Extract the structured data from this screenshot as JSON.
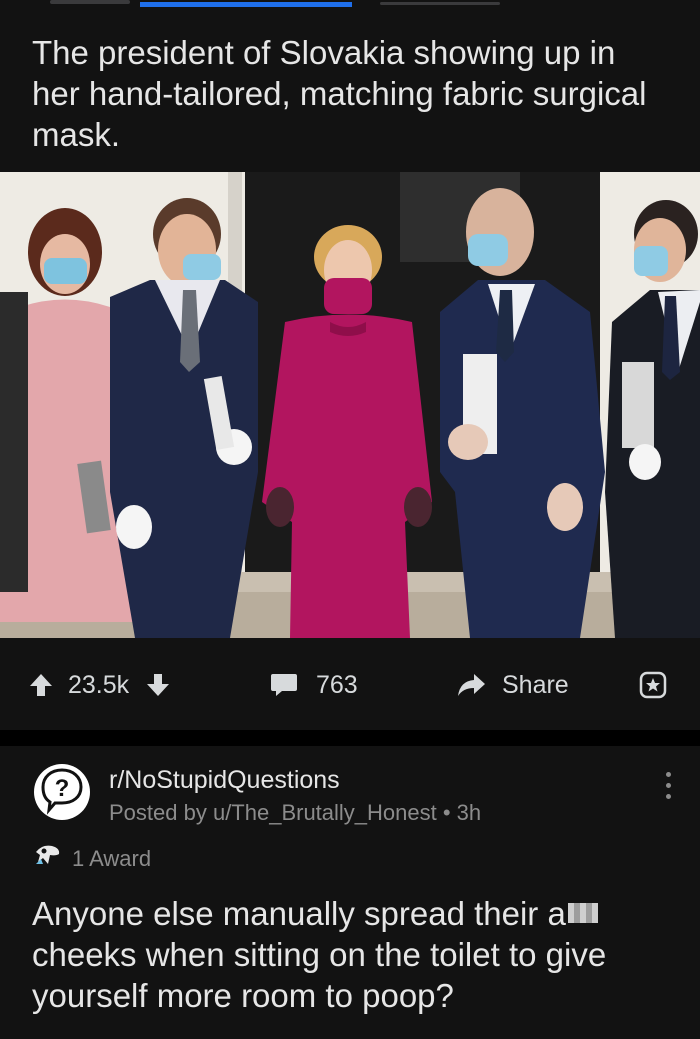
{
  "post1": {
    "title": "The president of Slovakia showing up in her hand-tailored, matching fabric surgical mask.",
    "image_alt": "Photo of the president of Slovakia in a magenta dress and matching mask standing with men in suits",
    "actions": {
      "score": "23.5k",
      "comments": "763",
      "share_label": "Share"
    }
  },
  "post2": {
    "subreddit": "r/NoStupidQuestions",
    "posted_by": "Posted by u/The_Brutally_Honest • 3h",
    "award_text": "1 Award",
    "title_before": "Anyone else manually spread their a",
    "title_after": " cheeks when sitting on the toilet to give yourself more room to poop?"
  },
  "colors": {
    "background": "#121212",
    "separator": "#000000",
    "text_primary": "#e6e6e6",
    "text_secondary": "#8c8c8c",
    "dress_magenta": "#b2155f"
  },
  "icons": {
    "upvote": "arrow-up-icon",
    "downvote": "arrow-down-icon",
    "comments": "comment-bubble-icon",
    "share": "share-arrow-icon",
    "award": "award-icon",
    "subreddit": "question-mark-icon",
    "more": "kebab-menu-icon",
    "award_badge": "award-badge-icon"
  }
}
